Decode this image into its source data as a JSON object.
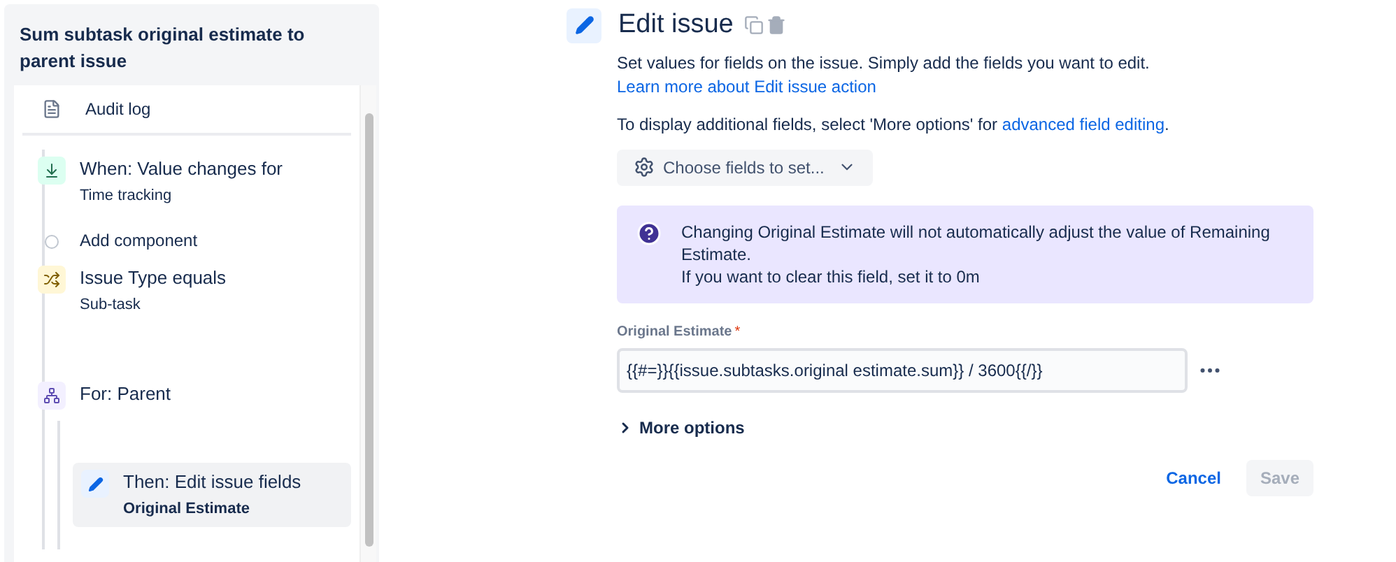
{
  "rule": {
    "title": "Sum subtask original estimate to parent issue",
    "audit_log": "Audit log",
    "steps": [
      {
        "kind": "trigger",
        "title": "When: Value changes for",
        "detail": "Time tracking",
        "selected": false
      },
      {
        "kind": "add",
        "title": "Add component",
        "selected": false
      },
      {
        "kind": "condition",
        "title": "Issue Type equals",
        "detail": "Sub-task",
        "selected": false
      },
      {
        "kind": "branch",
        "title": "For: Parent",
        "selected": false,
        "children": [
          {
            "kind": "action",
            "title": "Then: Edit issue fields",
            "detail": "Original Estimate",
            "selected": true
          }
        ]
      }
    ]
  },
  "editor": {
    "title": "Edit issue",
    "description": "Set values for fields on the issue. Simply add the fields you want to edit.",
    "description_link": "Learn more about Edit issue action",
    "hint": "To display additional fields, select 'More options' for",
    "hint_link": "advanced field editing",
    "hint_end": ".",
    "choose_button": "Choose fields to set...",
    "notice": [
      "Changing Original Estimate will not automatically adjust the value of Remaining Estimate.",
      "If you want to clear this field, set it to 0m"
    ],
    "field": {
      "label": "Original Estimate",
      "required_mark": "*",
      "value": "{{#=}}{{issue.subtasks.original estimate.sum}} / 3600{{/}}"
    },
    "more_options": "More options",
    "cancel": "Cancel",
    "save": {
      "label": "Save",
      "disabled": true
    }
  }
}
